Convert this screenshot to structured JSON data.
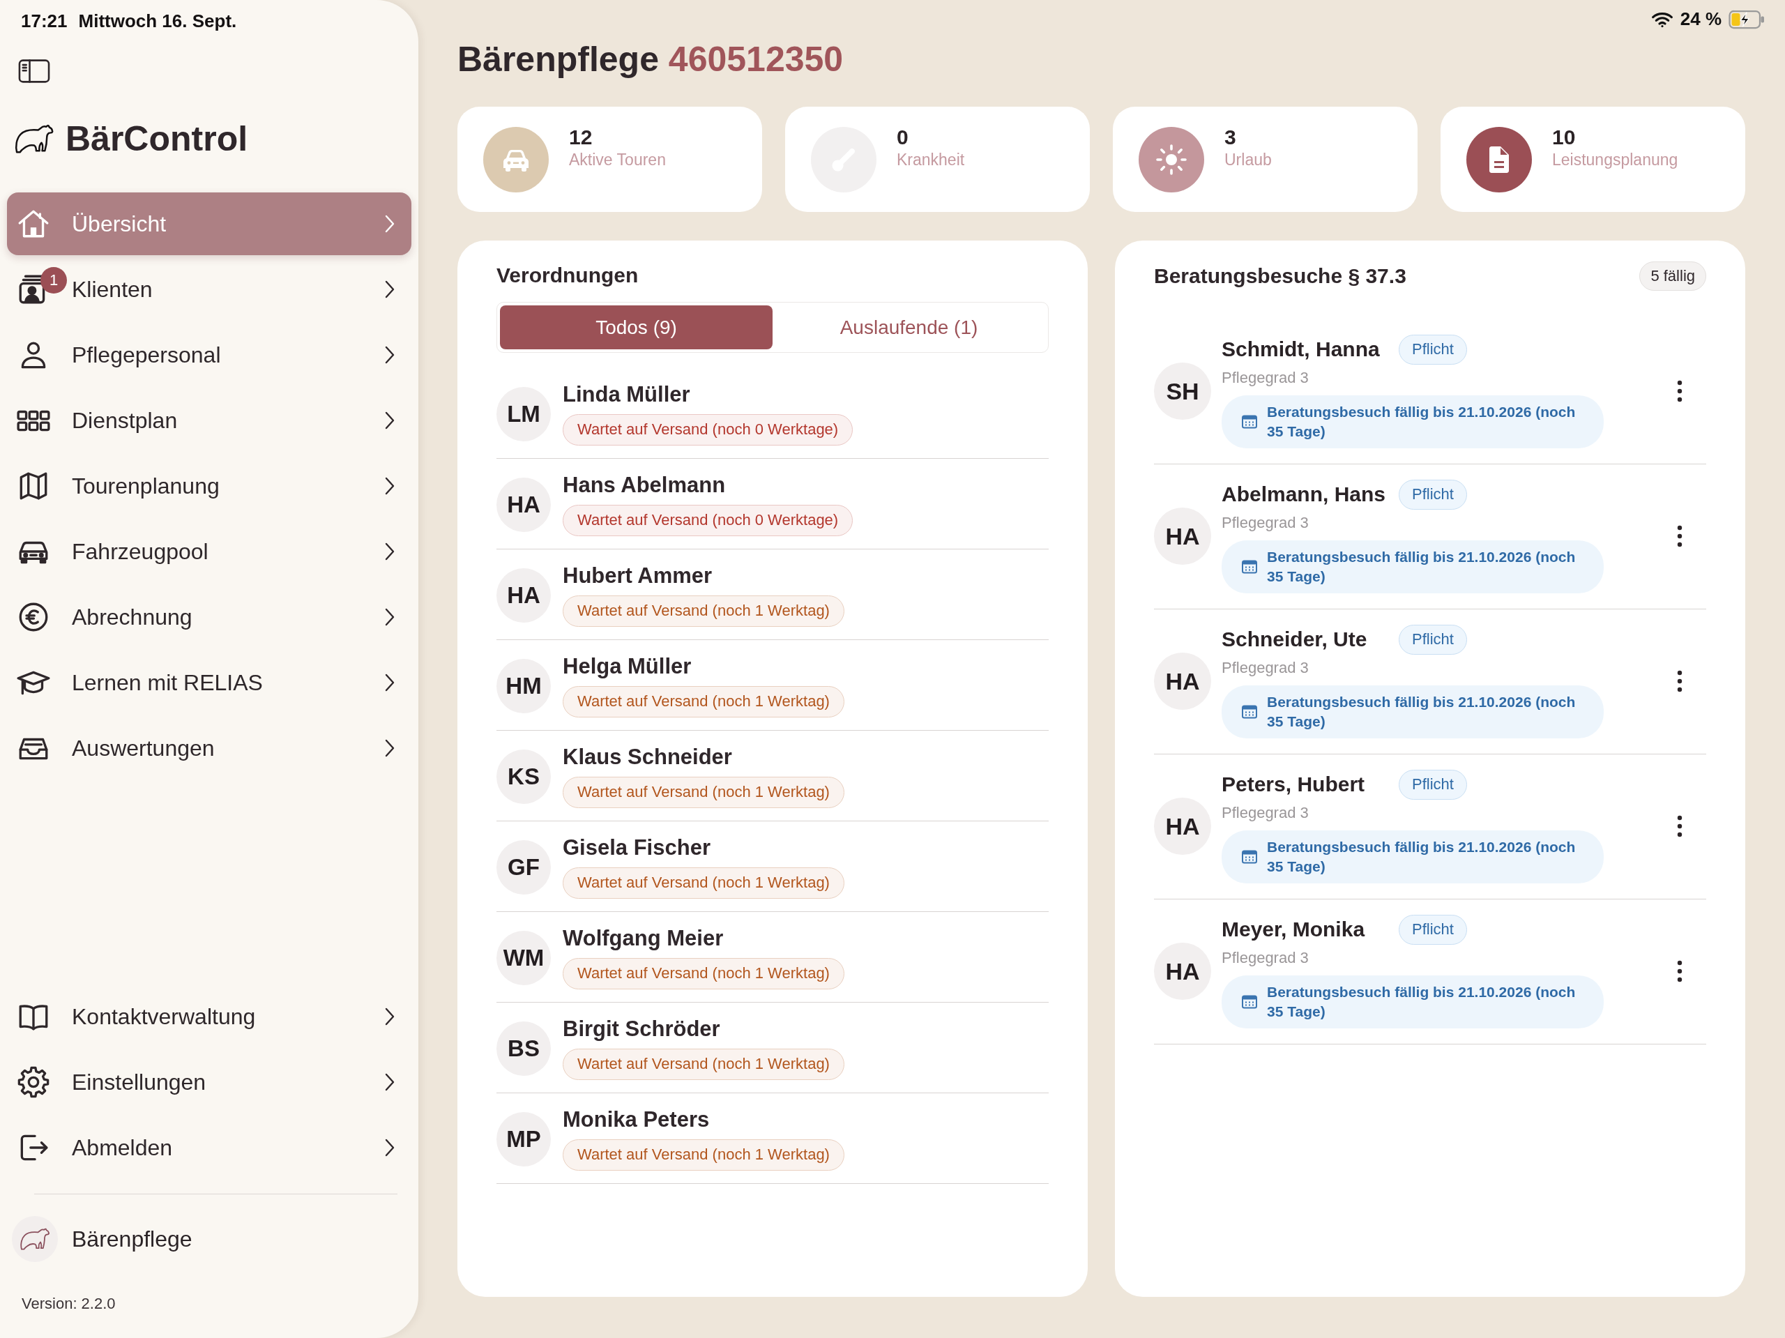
{
  "status_bar": {
    "time": "17:21",
    "date": "Mittwoch 16. Sept.",
    "battery": "24 %"
  },
  "sidebar": {
    "app_name": "BärControl",
    "items": [
      {
        "label": "Übersicht",
        "selected": true
      },
      {
        "label": "Klienten",
        "selected": false,
        "badge": "1"
      },
      {
        "label": "Pflegepersonal",
        "selected": false
      },
      {
        "label": "Dienstplan",
        "selected": false
      },
      {
        "label": "Tourenplanung",
        "selected": false
      },
      {
        "label": "Fahrzeugpool",
        "selected": false
      },
      {
        "label": "Abrechnung",
        "selected": false
      },
      {
        "label": "Lernen mit RELIAS",
        "selected": false
      },
      {
        "label": "Auswertungen",
        "selected": false
      }
    ],
    "bottom_items": [
      {
        "label": "Kontaktverwaltung",
        "selected": false
      },
      {
        "label": "Einstellungen",
        "selected": false
      },
      {
        "label": "Abmelden",
        "selected": false
      }
    ],
    "organization": "Bärenpflege",
    "version": "Version: 2.2.0"
  },
  "header": {
    "title": "Bärenpflege",
    "number": "460512350"
  },
  "stats": [
    {
      "value": "12",
      "label": "Aktive Touren",
      "color": "#dccab0"
    },
    {
      "value": "0",
      "label": "Krankheit",
      "color": "#f2f0f0"
    },
    {
      "value": "3",
      "label": "Urlaub",
      "color": "#c4979c"
    },
    {
      "value": "10",
      "label": "Leistungsplanung",
      "color": "#9b4f55"
    }
  ],
  "prescriptions": {
    "title": "Verordnungen",
    "tabs": [
      {
        "label": "Todos (9)",
        "selected": true
      },
      {
        "label": "Auslaufende (1)",
        "selected": false
      }
    ],
    "rows": [
      {
        "initials": "LM",
        "name": "Linda Müller",
        "status": "Wartet auf Versand (noch 0 Werktage)",
        "color": "#b3372d"
      },
      {
        "initials": "HA",
        "name": "Hans Abelmann",
        "status": "Wartet auf Versand (noch 0 Werktage)",
        "color": "#b3372d"
      },
      {
        "initials": "HA",
        "name": "Hubert Ammer",
        "status": "Wartet auf Versand (noch 1 Werktag)",
        "color": "#b2561e"
      },
      {
        "initials": "HM",
        "name": "Helga Müller",
        "status": "Wartet auf Versand (noch 1 Werktag)",
        "color": "#b2561e"
      },
      {
        "initials": "KS",
        "name": "Klaus Schneider",
        "status": "Wartet auf Versand (noch 1 Werktag)",
        "color": "#b2561e"
      },
      {
        "initials": "GF",
        "name": "Gisela Fischer",
        "status": "Wartet auf Versand (noch 1 Werktag)",
        "color": "#b2561e"
      },
      {
        "initials": "WM",
        "name": "Wolfgang Meier",
        "status": "Wartet auf Versand (noch 1 Werktag)",
        "color": "#b2561e"
      },
      {
        "initials": "BS",
        "name": "Birgit Schröder",
        "status": "Wartet auf Versand (noch 1 Werktag)",
        "color": "#b2561e"
      },
      {
        "initials": "MP",
        "name": "Monika Peters",
        "status": "Wartet auf Versand (noch 1 Werktag)",
        "color": "#b2561e"
      }
    ]
  },
  "consultations": {
    "title": "Beratungsbesuche § 37.3",
    "count": "5 fällig",
    "rows": [
      {
        "initials": "SH",
        "name": "Schmidt, Hanna",
        "tag": "Pflicht",
        "care_level": "Pflegegrad 3",
        "due": "Beratungsbesuch fällig bis 21.10.2026 (noch 35 Tage)"
      },
      {
        "initials": "HA",
        "name": "Abelmann, Hans",
        "tag": "Pflicht",
        "care_level": "Pflegegrad 3",
        "due": "Beratungsbesuch fällig bis 21.10.2026 (noch 35 Tage)"
      },
      {
        "initials": "HA",
        "name": "Schneider, Ute",
        "tag": "Pflicht",
        "care_level": "Pflegegrad 3",
        "due": "Beratungsbesuch fällig bis 21.10.2026 (noch 35 Tage)"
      },
      {
        "initials": "HA",
        "name": "Peters, Hubert",
        "tag": "Pflicht",
        "care_level": "Pflegegrad 3",
        "due": "Beratungsbesuch fällig bis 21.10.2026 (noch 35 Tage)"
      },
      {
        "initials": "HA",
        "name": "Meyer, Monika",
        "tag": "Pflicht",
        "care_level": "Pflegegrad 3",
        "due": "Beratungsbesuch fällig bis 21.10.2026 (noch 35 Tage)"
      }
    ]
  }
}
